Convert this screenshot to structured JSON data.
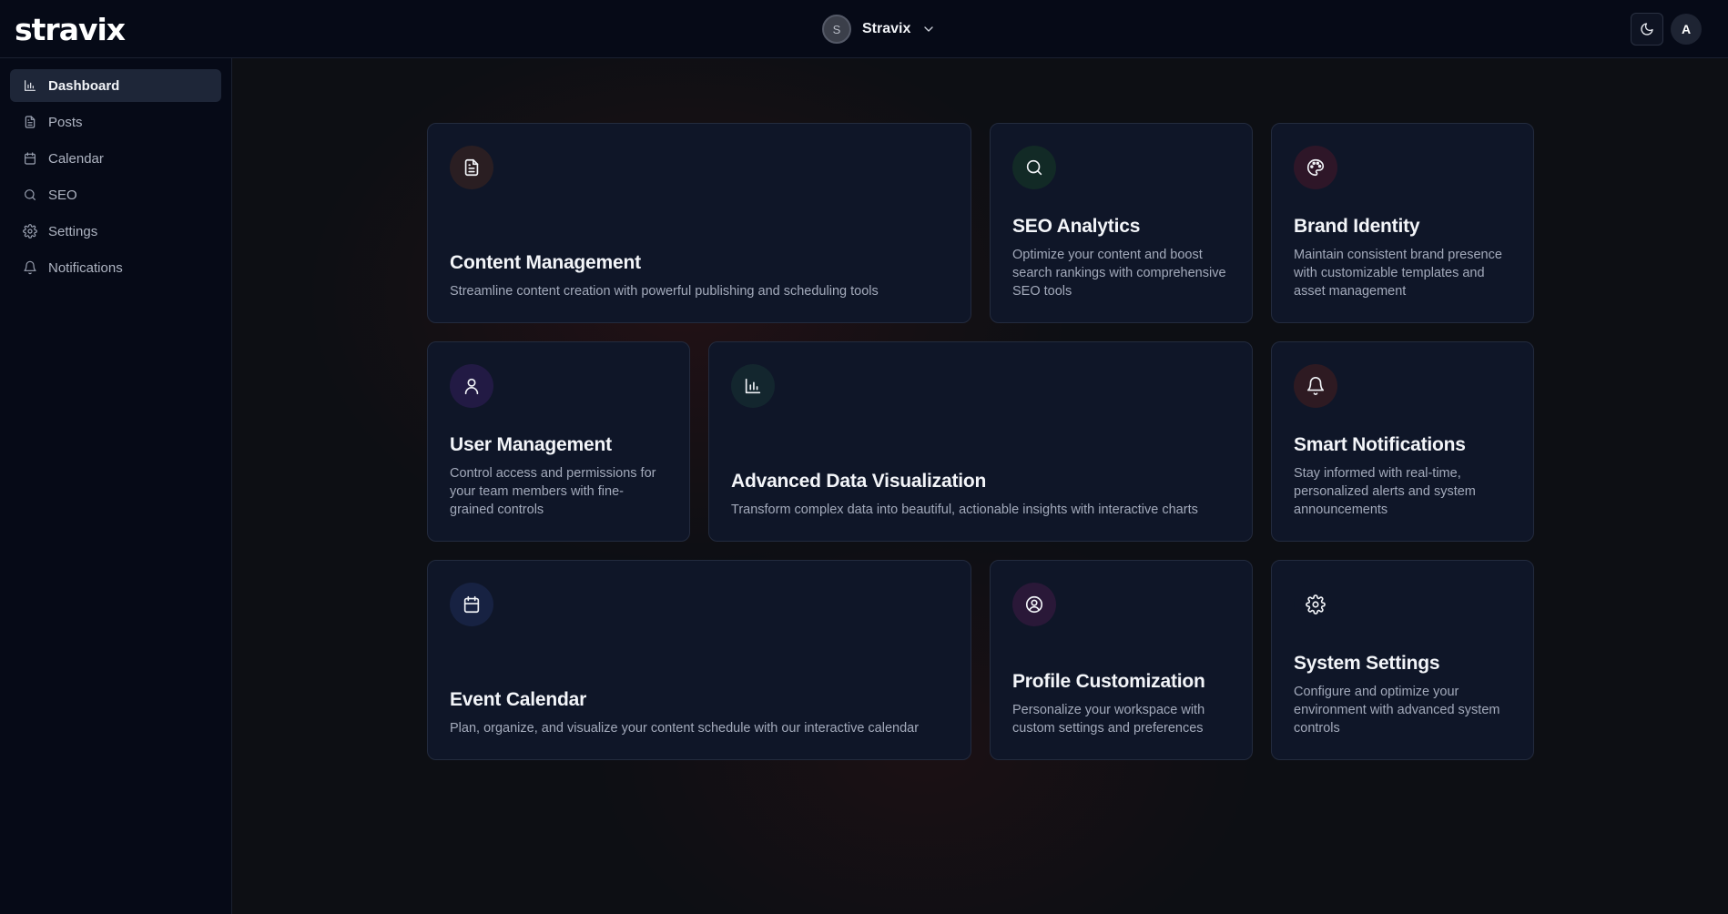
{
  "app": {
    "logo_text": "stravix"
  },
  "header": {
    "workspace_initial": "S",
    "workspace_name": "Stravix",
    "user_initial": "A"
  },
  "sidebar": {
    "items": [
      {
        "label": "Dashboard",
        "icon": "bar-chart-icon",
        "active": true
      },
      {
        "label": "Posts",
        "icon": "file-text-icon"
      },
      {
        "label": "Calendar",
        "icon": "calendar-icon"
      },
      {
        "label": "SEO",
        "icon": "search-icon"
      },
      {
        "label": "Settings",
        "icon": "gear-icon"
      },
      {
        "label": "Notifications",
        "icon": "bell-icon"
      }
    ]
  },
  "cards": [
    {
      "title": "Content Management",
      "description": "Streamline content creation with powerful publishing and scheduling tools",
      "icon": "file-text-icon",
      "icon_bg": "#2a1e22"
    },
    {
      "title": "SEO Analytics",
      "description": "Optimize your content and boost search rankings with comprehensive SEO tools",
      "icon": "search-icon",
      "icon_bg": "#122a26"
    },
    {
      "title": "Brand Identity",
      "description": "Maintain consistent brand presence with customizable templates and asset management",
      "icon": "palette-icon",
      "icon_bg": "#2e1628"
    },
    {
      "title": "User Management",
      "description": "Control access and permissions for your team members with fine-grained controls",
      "icon": "user-icon",
      "icon_bg": "#221a44"
    },
    {
      "title": "Advanced Data Visualization",
      "description": "Transform complex data into beautiful, actionable insights with interactive charts",
      "icon": "bar-chart-icon",
      "icon_bg": "#13262e"
    },
    {
      "title": "Smart Notifications",
      "description": "Stay informed with real-time, personalized alerts and system announcements",
      "icon": "bell-icon",
      "icon_bg": "#2e1a22"
    },
    {
      "title": "Event Calendar",
      "description": "Plan, organize, and visualize your content schedule with our interactive calendar",
      "icon": "calendar-icon",
      "icon_bg": "#172242"
    },
    {
      "title": "Profile Customization",
      "description": "Personalize your workspace with custom settings and preferences",
      "icon": "user-circle-icon",
      "icon_bg": "#2a1838"
    },
    {
      "title": "System Settings",
      "description": "Configure and optimize your environment with advanced system controls",
      "icon": "gear-icon",
      "icon_bg": "#0f1628"
    }
  ],
  "colors": {
    "background": "#0d0f14",
    "panel": "#060a17",
    "card": "#0f1628",
    "active_nav": "#1e2638",
    "logo_accent": "#8b3df0"
  }
}
